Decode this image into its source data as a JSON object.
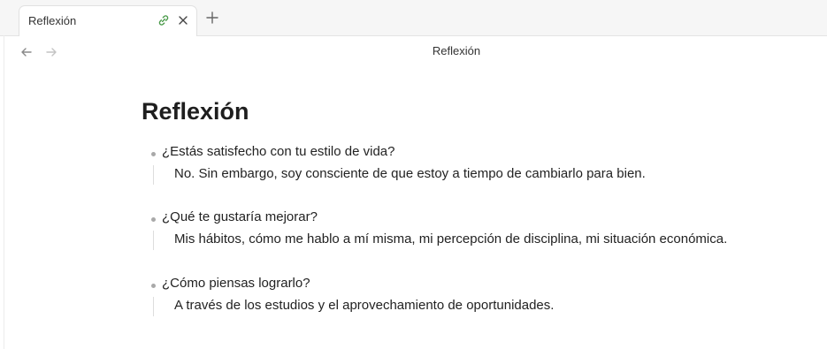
{
  "tab": {
    "title": "Reflexión"
  },
  "header": {
    "title": "Reflexión"
  },
  "document": {
    "title": "Reflexión",
    "items": [
      {
        "question": "¿Estás satisfecho con tu estilo de vida?",
        "answer": "No. Sin embargo, soy consciente de que estoy a tiempo de cambiarlo para bien."
      },
      {
        "question": "¿Qué te gustaría mejorar?",
        "answer": "Mis hábitos, cómo me hablo a mí misma, mi percepción de disciplina, mi situación económica."
      },
      {
        "question": "¿Cómo piensas lograrlo?",
        "answer": "A través de los estudios y el aprovechamiento de oportunidades."
      }
    ]
  },
  "icons": {
    "tab_link": "link-icon",
    "tab_close": "close-icon",
    "new_tab": "plus-icon",
    "back": "arrow-left-icon",
    "forward": "arrow-right-icon"
  },
  "colors": {
    "link_icon": "#4a9a4a",
    "tab_strip_bg": "#f6f6f6",
    "bullet": "#a9a9a9"
  }
}
